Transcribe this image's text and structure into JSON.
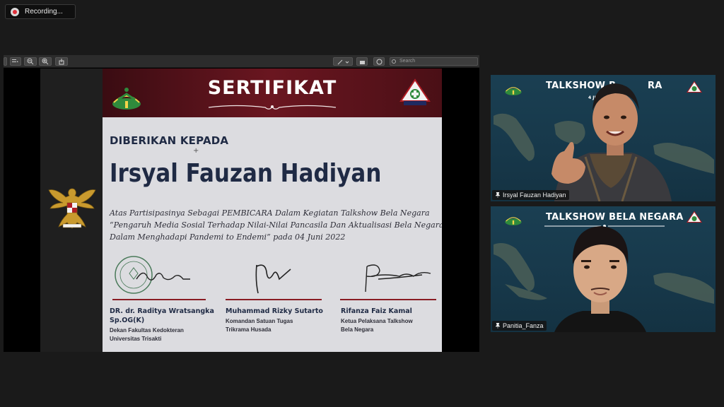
{
  "recording": {
    "label": "Recording..."
  },
  "viewer": {
    "search_placeholder": "Search"
  },
  "certificate": {
    "title": "SERTIFIKAT",
    "given_to": "DIBERIKAN KEPADA",
    "recipient": "Irsyal Fauzan Hadiyan",
    "body_lines": [
      "Atas Partisipasinya Sebagai PEMBICARA Dalam Kegiatan Talkshow Bela Negara",
      "“Pengaruh Media Sosial Terhadap Nilai-Nilai Pancasila Dan Aktualisasi Bela Negara",
      "Dalam Menghadapi Pandemi to Endemi” pada 04 Juni 2022"
    ],
    "signatories": [
      {
        "name_line1": "DR. dr. Raditya Wratsangka",
        "name_line2": "Sp.OG(K)",
        "role_line1": "Dekan Fakultas Kedokteran",
        "role_line2": "Universitas Trisakti"
      },
      {
        "name_line1": "Muhammad Rizky Sutarto",
        "role_line1": "Komandan Satuan Tugas",
        "role_line2": "Trikrama Husada"
      },
      {
        "name_line1": "Rifanza Faiz Kamal",
        "role_line1": "Ketua Pelaksana Talkshow",
        "role_line2": "Bela Negara"
      }
    ],
    "accent": "#8a1c24",
    "header_color": "#5a1219",
    "text_color": "#1f2a44"
  },
  "participants": [
    {
      "name": "Irsyal Fauzan Hadiyan",
      "heading": "TALKSHOW B",
      "heading_tail": "RA",
      "date": "4 JU"
    },
    {
      "name": "Panitia_Fanza",
      "heading": "TALKSHOW BELA NEGARA"
    }
  ]
}
